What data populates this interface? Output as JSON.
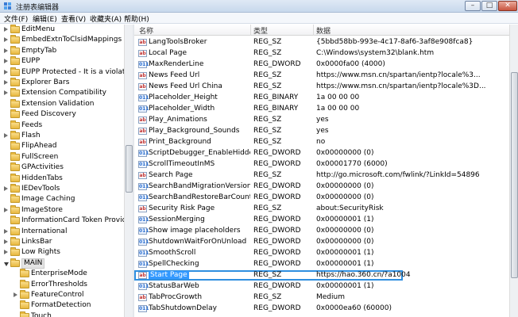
{
  "window": {
    "title": "注册表编辑器",
    "minimize_label": "–",
    "maximize_label": "□",
    "close_label": "✕"
  },
  "menu": [
    "文件(F)",
    "编辑(E)",
    "查看(V)",
    "收藏夹(A)",
    "帮助(H)"
  ],
  "tree": {
    "items": [
      {
        "label": "EditMenu",
        "expander": "closed",
        "level": 0
      },
      {
        "label": "EmbedExtnToClsidMappings",
        "expander": "closed",
        "level": 0
      },
      {
        "label": "EmptyTab",
        "expander": "closed",
        "level": 0
      },
      {
        "label": "EUPP",
        "expander": "closed",
        "level": 0
      },
      {
        "label": "EUPP Protected - It is a violation",
        "expander": "closed",
        "level": 0
      },
      {
        "label": "Explorer Bars",
        "expander": "closed",
        "level": 0
      },
      {
        "label": "Extension Compatibility",
        "expander": "closed",
        "level": 0
      },
      {
        "label": "Extension Validation",
        "expander": "none",
        "level": 0
      },
      {
        "label": "Feed Discovery",
        "expander": "none",
        "level": 0
      },
      {
        "label": "Feeds",
        "expander": "none",
        "level": 0
      },
      {
        "label": "Flash",
        "expander": "closed",
        "level": 0
      },
      {
        "label": "FlipAhead",
        "expander": "none",
        "level": 0
      },
      {
        "label": "FullScreen",
        "expander": "none",
        "level": 0
      },
      {
        "label": "GPActivities",
        "expander": "none",
        "level": 0
      },
      {
        "label": "HiddenTabs",
        "expander": "none",
        "level": 0
      },
      {
        "label": "IEDevTools",
        "expander": "closed",
        "level": 0
      },
      {
        "label": "Image Caching",
        "expander": "none",
        "level": 0
      },
      {
        "label": "ImageStore",
        "expander": "closed",
        "level": 0
      },
      {
        "label": "InformationCard Token Provider",
        "expander": "none",
        "level": 0
      },
      {
        "label": "International",
        "expander": "closed",
        "level": 0
      },
      {
        "label": "LinksBar",
        "expander": "closed",
        "level": 0
      },
      {
        "label": "Low Rights",
        "expander": "closed",
        "level": 0
      },
      {
        "label": "MAIN",
        "expander": "open",
        "level": 0,
        "selected": true
      },
      {
        "label": "EnterpriseMode",
        "expander": "none",
        "level": 1
      },
      {
        "label": "ErrorThresholds",
        "expander": "none",
        "level": 1
      },
      {
        "label": "FeatureControl",
        "expander": "closed",
        "level": 1
      },
      {
        "label": "FormatDetection",
        "expander": "none",
        "level": 1
      },
      {
        "label": "Touch",
        "expander": "none",
        "level": 1
      }
    ]
  },
  "list": {
    "headers": {
      "name": "名称",
      "type": "类型",
      "data": "数据"
    },
    "rows": [
      {
        "name": "LangToolsBroker",
        "type": "REG_SZ",
        "data": "{5bbd58bb-993e-4c17-8af6-3af8e908fca8}",
        "icon": "string"
      },
      {
        "name": "Local Page",
        "type": "REG_SZ",
        "data": "C:\\Windows\\system32\\blank.htm",
        "icon": "string"
      },
      {
        "name": "MaxRenderLine",
        "type": "REG_DWORD",
        "data": "0x0000fa00 (4000)",
        "icon": "binary"
      },
      {
        "name": "News Feed Url",
        "type": "REG_SZ",
        "data": "https://www.msn.cn/spartan/ientp?locale%3...",
        "icon": "string"
      },
      {
        "name": "News Feed Url China",
        "type": "REG_SZ",
        "data": "https://www.msn.cn/spartan/ientp?locale%3D...",
        "icon": "string"
      },
      {
        "name": "Placeholder_Height",
        "type": "REG_BINARY",
        "data": "1a 00 00 00",
        "icon": "binary"
      },
      {
        "name": "Placeholder_Width",
        "type": "REG_BINARY",
        "data": "1a 00 00 00",
        "icon": "binary"
      },
      {
        "name": "Play_Animations",
        "type": "REG_SZ",
        "data": "yes",
        "icon": "string"
      },
      {
        "name": "Play_Background_Sounds",
        "type": "REG_SZ",
        "data": "yes",
        "icon": "string"
      },
      {
        "name": "Print_Background",
        "type": "REG_SZ",
        "data": "no",
        "icon": "string"
      },
      {
        "name": "ScriptDebugger_EnableHidden...",
        "type": "REG_DWORD",
        "data": "0x00000000 (0)",
        "icon": "binary"
      },
      {
        "name": "ScrollTimeoutInMS",
        "type": "REG_DWORD",
        "data": "0x00001770 (6000)",
        "icon": "binary"
      },
      {
        "name": "Search Page",
        "type": "REG_SZ",
        "data": "http://go.microsoft.com/fwlink/?LinkId=54896",
        "icon": "string"
      },
      {
        "name": "SearchBandMigrationVersion",
        "type": "REG_DWORD",
        "data": "0x00000000 (0)",
        "icon": "binary"
      },
      {
        "name": "SearchBandRestoreBarCount",
        "type": "REG_DWORD",
        "data": "0x00000000 (0)",
        "icon": "binary"
      },
      {
        "name": "Security Risk Page",
        "type": "REG_SZ",
        "data": "about:SecurityRisk",
        "icon": "string"
      },
      {
        "name": "SessionMerging",
        "type": "REG_DWORD",
        "data": "0x00000001 (1)",
        "icon": "binary"
      },
      {
        "name": "Show image placeholders",
        "type": "REG_DWORD",
        "data": "0x00000000 (0)",
        "icon": "binary"
      },
      {
        "name": "ShutdownWaitForOnUnload",
        "type": "REG_DWORD",
        "data": "0x00000000 (0)",
        "icon": "binary"
      },
      {
        "name": "SmoothScroll",
        "type": "REG_DWORD",
        "data": "0x00000001 (1)",
        "icon": "binary"
      },
      {
        "name": "SpellChecking",
        "type": "REG_DWORD",
        "data": "0x00000001 (1)",
        "icon": "binary"
      },
      {
        "name": "Start Page",
        "type": "REG_SZ",
        "data": "https://hao.360.cn/?a1004",
        "icon": "string",
        "selected": true
      },
      {
        "name": "StatusBarWeb",
        "type": "REG_DWORD",
        "data": "0x00000001 (1)",
        "icon": "binary"
      },
      {
        "name": "TabProcGrowth",
        "type": "REG_SZ",
        "data": "Medium",
        "icon": "string"
      },
      {
        "name": "TabShutdownDelay",
        "type": "REG_DWORD",
        "data": "0x0000ea60 (60000)",
        "icon": "binary"
      }
    ]
  }
}
